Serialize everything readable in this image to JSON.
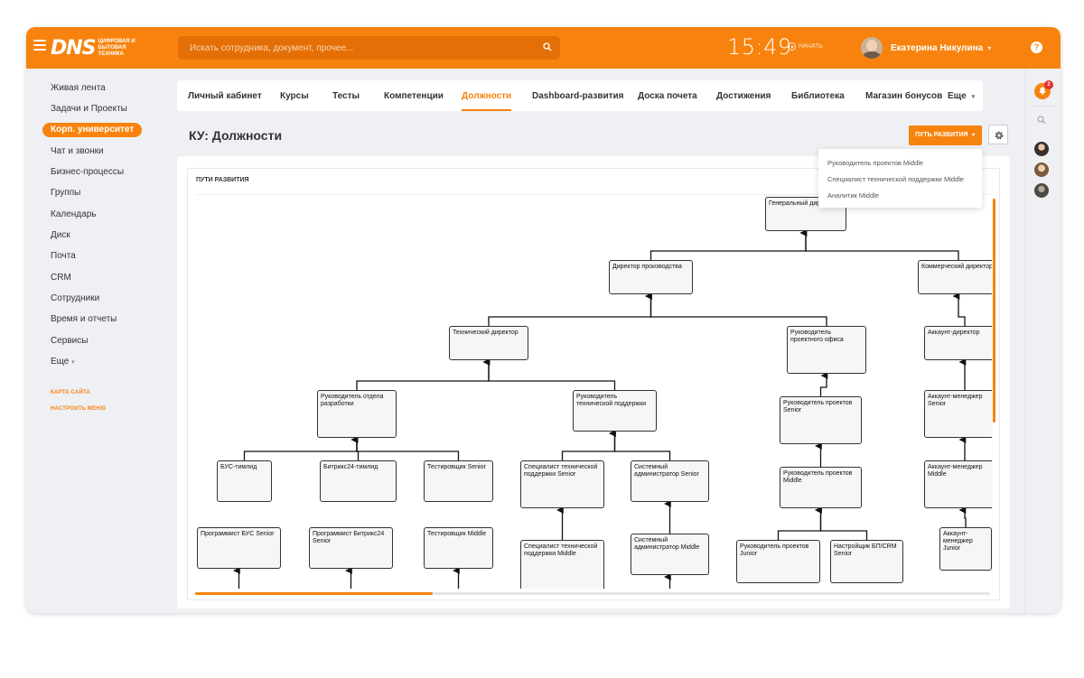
{
  "header": {
    "logo_text": "DNS",
    "logo_subtitle": "ЦИФРОВАЯ И БЫТОВАЯ ТЕХНИКА",
    "search_placeholder": "Искать сотрудника, документ, прочее...",
    "time": "15:49",
    "start_label": "НАЧАТЬ",
    "user_name": "Екатерина Никулина",
    "help_label": "?"
  },
  "left_menu": {
    "items": [
      "Живая лента",
      "Задачи и Проекты",
      "Корп. университет",
      "Чат и звонки",
      "Бизнес-процессы",
      "Группы",
      "Календарь",
      "Диск",
      "Почта",
      "CRM",
      "Сотрудники",
      "Время и отчеты",
      "Сервисы",
      "Еще"
    ],
    "active_index": 2,
    "links": [
      "КАРТА САЙТА",
      "НАСТРОИТЬ МЕНЮ"
    ]
  },
  "right_rail": {
    "notification_count": "2"
  },
  "tabs": {
    "items": [
      "Личный кабинет",
      "Курсы",
      "Тесты",
      "Компетенции",
      "Должности",
      "Dashboard-развития",
      "Доска почета",
      "Достижения",
      "Библиотека",
      "Магазин бонусов",
      "Еще"
    ],
    "active_index": 4
  },
  "page": {
    "title": "КУ: Должности",
    "path_button": "ПУТЬ РАЗВИТИЯ",
    "dropdown_items": [
      "Руководитель проектов Middle",
      "Специалист технической поддержки Middle",
      "Аналитик Middle"
    ],
    "section_title": "ПУТИ РАЗВИТИЯ"
  },
  "tree": {
    "nodes": [
      {
        "id": "gen",
        "label": "Генеральный директор"
      },
      {
        "id": "prod",
        "label": "Директор производства"
      },
      {
        "id": "comm",
        "label": "Коммерческий директор"
      },
      {
        "id": "tech",
        "label": "Технический директор"
      },
      {
        "id": "rpo",
        "label": "Руководитель проектного офиса"
      },
      {
        "id": "akdir",
        "label": "Аккаунт-директор"
      },
      {
        "id": "rod",
        "label": "Руководитель отдела разработки"
      },
      {
        "id": "rtp",
        "label": "Руководитель технической поддержки"
      },
      {
        "id": "rps",
        "label": "Руководитель проектов Senior"
      },
      {
        "id": "ams",
        "label": "Аккаунт-менеджер Senior"
      },
      {
        "id": "bus",
        "label": "БУС-тимлид"
      },
      {
        "id": "b24",
        "label": "Битрикс24-тимлид"
      },
      {
        "id": "tss",
        "label": "Тестировщик Senior"
      },
      {
        "id": "stps",
        "label": "Специалист технической поддержки Senior"
      },
      {
        "id": "sas",
        "label": "Системный администратор Senior"
      },
      {
        "id": "rpm",
        "label": "Руководитель проектов Middle"
      },
      {
        "id": "amm",
        "label": "Аккаунт-менеджер Middle"
      },
      {
        "id": "pbus",
        "label": "Программист БУС Senior"
      },
      {
        "id": "pb24",
        "label": "Программист Битрикс24 Senior"
      },
      {
        "id": "tsm",
        "label": "Тестировщик Middle"
      },
      {
        "id": "stpm",
        "label": "Специалист технической поддержки Middle"
      },
      {
        "id": "sam",
        "label": "Системный администратор Middle"
      },
      {
        "id": "rpj",
        "label": "Руководитель проектов Junior"
      },
      {
        "id": "nbp",
        "label": "Настройщик БП/CRM Senior"
      },
      {
        "id": "amj",
        "label": "Аккаунт-менеджер Junior"
      }
    ],
    "edges": [
      [
        "prod",
        "gen"
      ],
      [
        "comm",
        "gen"
      ],
      [
        "tech",
        "prod"
      ],
      [
        "rpo",
        "prod"
      ],
      [
        "ams",
        "akdir"
      ],
      [
        "amm",
        "ams"
      ],
      [
        "amj",
        "amm"
      ],
      [
        "rod",
        "tech"
      ],
      [
        "rtp",
        "tech"
      ],
      [
        "rps",
        "rpo"
      ],
      [
        "rpm",
        "rps"
      ],
      [
        "rpj",
        "rpm"
      ],
      [
        "nbp",
        "rpm"
      ],
      [
        "bus",
        "rod"
      ],
      [
        "b24",
        "rod"
      ],
      [
        "tss",
        "rod"
      ],
      [
        "stps",
        "rtp"
      ],
      [
        "sas",
        "rtp"
      ],
      [
        "stpm",
        "stps"
      ],
      [
        "sam",
        "sas"
      ],
      [
        "akdir",
        "comm"
      ]
    ]
  }
}
